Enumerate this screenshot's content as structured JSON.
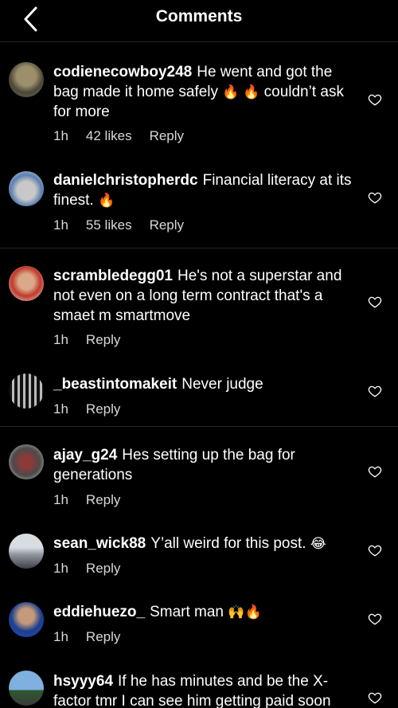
{
  "header": {
    "title": "Comments"
  },
  "comments": [
    {
      "username": "codienecowboy248",
      "text_before": "He went and got the bag made it home safely",
      "emoji": "🔥 🔥",
      "text_after": " couldn’t ask for more",
      "time": "1h",
      "likes": "42 likes",
      "reply": "Reply"
    },
    {
      "username": "danielchristopherdc",
      "text_before": "Financial literacy at its finest.",
      "emoji": "🔥",
      "text_after": "",
      "time": "1h",
      "likes": "55 likes",
      "reply": "Reply"
    },
    {
      "username": "scrambledegg01",
      "text_before": "He's not a superstar and not even on a long term contract that's a smaet m smartmove",
      "emoji": "",
      "text_after": "",
      "time": "1h",
      "likes": "",
      "reply": "Reply"
    },
    {
      "username": "_beastintomakeit",
      "text_before": "Never judge",
      "emoji": "",
      "text_after": "",
      "time": "1h",
      "likes": "",
      "reply": "Reply"
    },
    {
      "username": "ajay_g24",
      "text_before": "Hes setting up the bag for generations",
      "emoji": "",
      "text_after": "",
      "time": "1h",
      "likes": "",
      "reply": "Reply"
    },
    {
      "username": "sean_wick88",
      "text_before": "Y’all weird for this post.",
      "emoji": "😂",
      "text_after": "",
      "time": "1h",
      "likes": "",
      "reply": "Reply"
    },
    {
      "username": "eddiehuezo_",
      "text_before": "Smart man",
      "emoji": "🙌🔥",
      "text_after": "",
      "time": "1h",
      "likes": "",
      "reply": "Reply"
    },
    {
      "username": "hsyyy64",
      "text_before": "If he has minutes and be the X-factor tmr I can see him getting paid soon",
      "emoji": "",
      "text_after": "",
      "time": "",
      "likes": "",
      "reply": ""
    }
  ],
  "icons": {
    "back": "chevron-left-icon",
    "like": "heart-outline-icon"
  },
  "colors": {
    "background": "#000000",
    "text": "#ffffff",
    "meta": "#d8d8d8",
    "divider": "#262626"
  }
}
